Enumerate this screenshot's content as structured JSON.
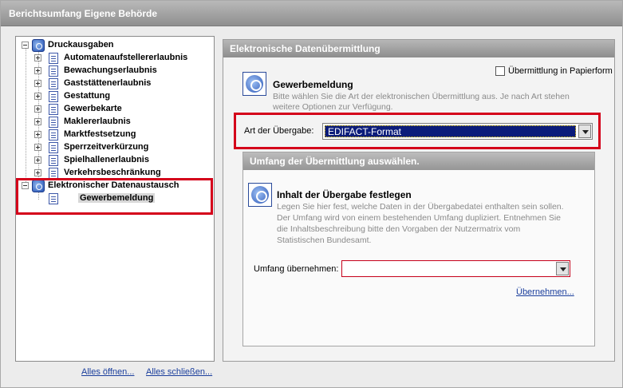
{
  "window": {
    "title": "Berichtsumfang Eigene Behörde"
  },
  "tree": {
    "root1": {
      "label": "Druckausgaben"
    },
    "items": [
      {
        "label": "Automatenaufstellererlaubnis"
      },
      {
        "label": "Bewachungserlaubnis"
      },
      {
        "label": "Gaststättenerlaubnis"
      },
      {
        "label": "Gestattung"
      },
      {
        "label": "Gewerbekarte"
      },
      {
        "label": "Maklererlaubnis"
      },
      {
        "label": "Marktfestsetzung"
      },
      {
        "label": "Sperrzeitverkürzung"
      },
      {
        "label": "Spielhallenerlaubnis"
      },
      {
        "label": "Verkehrsbeschränkung"
      }
    ],
    "root2": {
      "label": "Elektronischer Datenaustausch"
    },
    "child2": {
      "label": "Gewerbemeldung"
    }
  },
  "tree_actions": {
    "open_all": "Alles öffnen...",
    "close_all": "Alles schließen..."
  },
  "right": {
    "header": "Elektronische Datenübermittlung",
    "paper_checkbox": {
      "label": "Übermittlung in Papierform",
      "checked": false
    },
    "section": {
      "title": "Gewerbemeldung",
      "desc_line1": "Bitte wählen Sie die Art der elektronischen Übermittlung aus. Je nach Art stehen",
      "desc_line2": "weitere Optionen zur Verfügung."
    },
    "transfer_type": {
      "label": "Art der Übergabe:",
      "value": "EDIFACT-Format"
    },
    "scope": {
      "header": "Umfang der Übermittlung auswählen.",
      "title": "Inhalt der Übergabe festlegen",
      "desc": [
        "Legen Sie hier fest, welche Daten in der Übergabedatei enthalten sein sollen.",
        "Der Umfang wird von einem bestehenden Umfang dupliziert. Entnehmen Sie",
        "die Inhaltsbeschreibung bitte den Vorgaben der Nutzermatrix vom",
        "Statistischen Bundesamt."
      ],
      "field_label": "Umfang übernehmen:",
      "field_value": "",
      "apply_link": "Übernehmen..."
    }
  },
  "colors": {
    "highlight_border": "#d4001a",
    "selection": "#0b1c7a",
    "link": "#1a3e9c"
  }
}
